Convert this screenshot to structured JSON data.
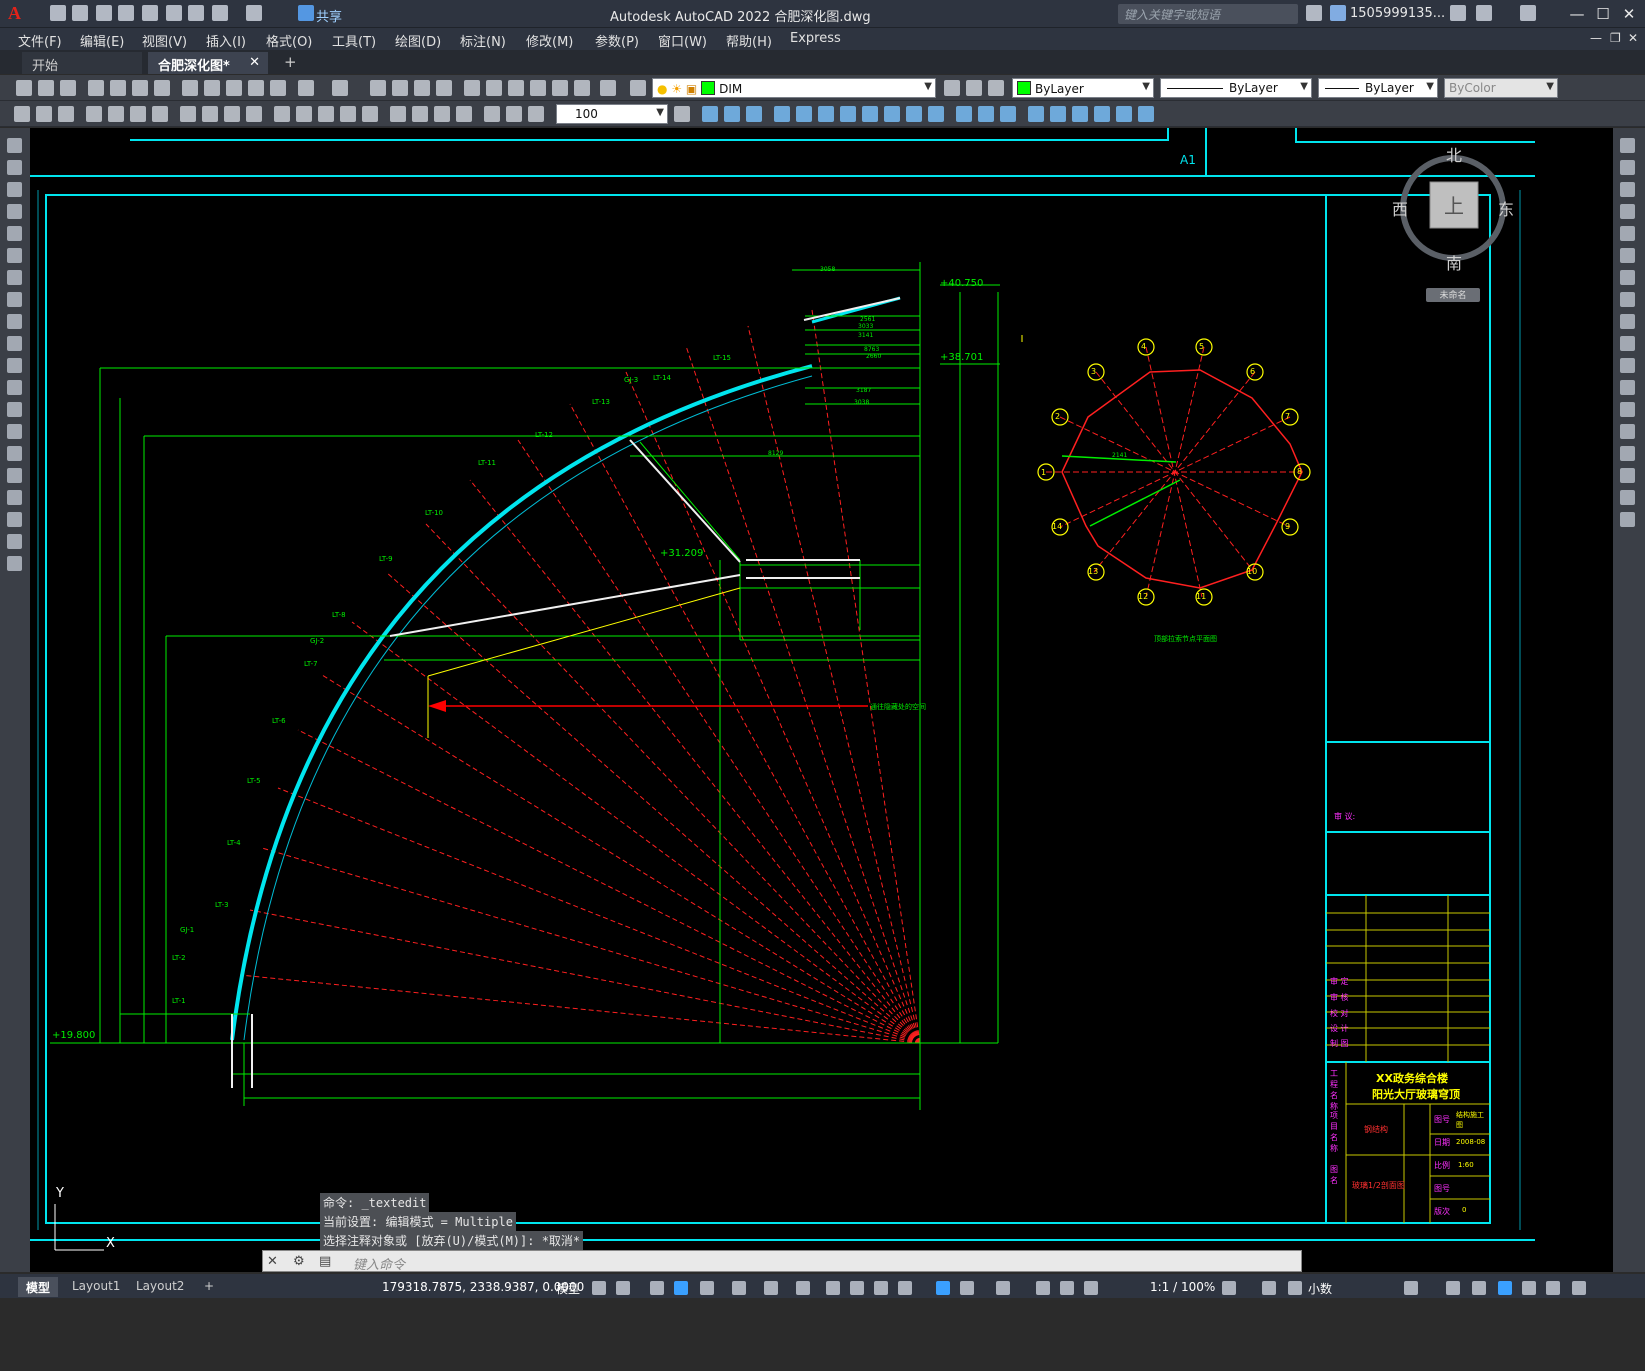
{
  "app": {
    "logo": "A",
    "title": "Autodesk AutoCAD 2022    合肥深化图.dwg",
    "share_label": "共享",
    "search_placeholder": "键入关键字或短语",
    "user": "1505999135...",
    "window_buttons": [
      "—",
      "☐",
      "✕"
    ]
  },
  "menu": [
    "文件(F)",
    "编辑(E)",
    "视图(V)",
    "插入(I)",
    "格式(O)",
    "工具(T)",
    "绘图(D)",
    "标注(N)",
    "修改(M)",
    "参数(P)",
    "窗口(W)",
    "帮助(H)",
    "Express"
  ],
  "doc_tabs": [
    {
      "label": "开始",
      "active": false
    },
    {
      "label": "合肥深化图*",
      "active": true
    }
  ],
  "doc_tab_close": "✕",
  "doc_tab_add": "+",
  "toolbar": {
    "layer": "DIM",
    "color": "ByLayer",
    "linetype": "ByLayer",
    "lineweight": "ByLayer",
    "plotstyle": "ByColor",
    "dimscale": "100",
    "color_swatch": "#00ff00"
  },
  "viewcube": {
    "north": "北",
    "south": "南",
    "east": "东",
    "west": "西",
    "top": "上",
    "ucs": "未命名"
  },
  "drawing": {
    "sheet_label": "A1",
    "elevations": [
      "+40.750",
      "+38.701",
      "+31.209",
      "+19.800"
    ],
    "node_labels": [
      "LT-15",
      "LT-14",
      "LT-13",
      "LT-12",
      "LT-11",
      "LT-10",
      "LT-9",
      "LT-8",
      "LT-7",
      "LT-6",
      "LT-5",
      "LT-4",
      "LT-3",
      "LT-2",
      "LT-1",
      "GJ-3",
      "GJ-2",
      "GJ-1"
    ],
    "circle_numbers": [
      "1",
      "2",
      "3",
      "4",
      "5",
      "6",
      "7",
      "8",
      "9",
      "10",
      "11",
      "12",
      "13",
      "14"
    ],
    "plan_caption": "顶部拉索节点平面图",
    "dim_texts": [
      "3058",
      "2561",
      "3033",
      "3141",
      "8763",
      "2660",
      "3187",
      "3038",
      "8129",
      "2141"
    ],
    "annotation_arrow": "通往隐藏处的空间",
    "ucs_y": "Y",
    "ucs_x": "X"
  },
  "title_block": {
    "review": "审 议:",
    "rows": [
      "审 定",
      "审 核",
      "校 对",
      "设 计",
      "制 图"
    ],
    "project_label": "工程名称",
    "project_name_1": "XX政务综合楼",
    "project_name_2": "阳光大厅玻璃穹顶",
    "item_label": "项目名称",
    "item_name": "钢结构",
    "drawing_label": "图名",
    "drawing_name": "玻璃1/2剖面图",
    "fields": [
      {
        "label": "图号",
        "value": "结构施工图"
      },
      {
        "label": "日期",
        "value": "2008-08"
      },
      {
        "label": "比例",
        "value": "1:60"
      },
      {
        "label": "图号",
        "value": ""
      },
      {
        "label": "版次",
        "value": "0"
      }
    ]
  },
  "command": {
    "history": [
      "命令: _textedit",
      "当前设置: 编辑模式 = Multiple",
      "选择注释对象或 [放弃(U)/模式(M)]: *取消*"
    ],
    "placeholder": "键入命令"
  },
  "layout_tabs": [
    {
      "label": "模型",
      "active": true
    },
    {
      "label": "Layout1",
      "active": false
    },
    {
      "label": "Layout2",
      "active": false
    }
  ],
  "layout_add": "+",
  "status": {
    "coords": "179318.7875, 2338.9387, 0.0000",
    "mode": "模型",
    "scale": "1:1 / 100%",
    "units": "小数"
  }
}
